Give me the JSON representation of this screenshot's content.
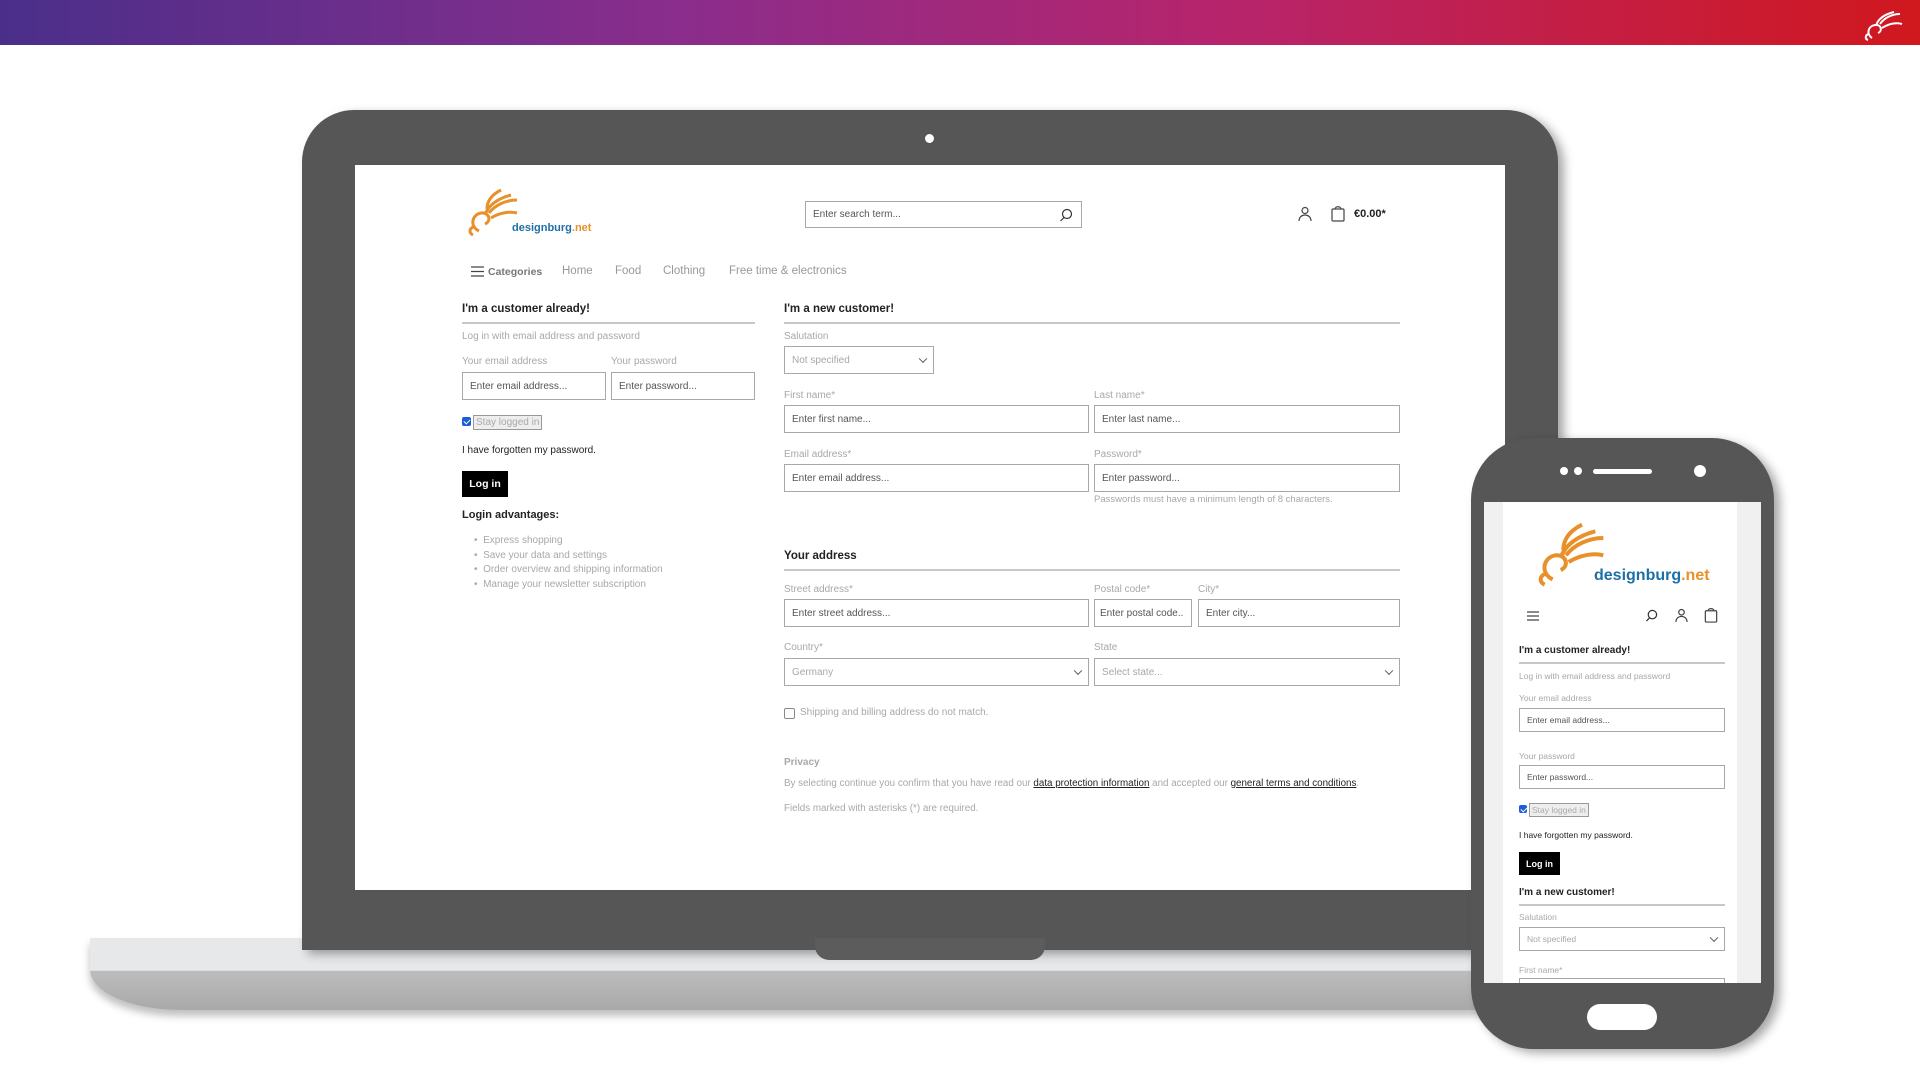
{
  "brand": {
    "name": "designburg",
    "tld": ".net",
    "colors": {
      "gradient_start": "#4a2f8a",
      "gradient_end": "#d0181e",
      "logo_orange": "#e8902a",
      "logo_blue": "#1d6fa8"
    }
  },
  "header": {
    "search_placeholder": "Enter search term...",
    "cart_total": "€0.00*",
    "icons": [
      "search-icon",
      "user-icon",
      "cart-icon"
    ]
  },
  "nav": {
    "categories": "Categories",
    "items": [
      "Home",
      "Food",
      "Clothing",
      "Free time & electronics"
    ]
  },
  "login": {
    "title": "I'm a customer already!",
    "subtitle": "Log in with email address and password",
    "email_label": "Your email address",
    "email_placeholder": "Enter email address...",
    "password_label": "Your password",
    "password_placeholder": "Enter password...",
    "stay_logged_in": "Stay logged in",
    "stay_logged_in_checked": true,
    "forgot": "I have forgotten my password.",
    "login_button": "Log in",
    "advantages_title": "Login advantages:",
    "advantages": [
      "Express shopping",
      "Save your data and settings",
      "Order overview and shipping information",
      "Manage your newsletter subscription"
    ]
  },
  "register": {
    "title": "I'm a new customer!",
    "salutation_label": "Salutation",
    "salutation_value": "Not specified",
    "first_name_label": "First name*",
    "first_name_placeholder": "Enter first name...",
    "last_name_label": "Last name*",
    "last_name_placeholder": "Enter last name...",
    "email_label": "Email address*",
    "email_placeholder": "Enter email address...",
    "password_label": "Password*",
    "password_placeholder": "Enter password...",
    "password_hint": "Passwords must have a minimum length of 8 characters.",
    "address_title": "Your address",
    "street_label": "Street address*",
    "street_placeholder": "Enter street address...",
    "postal_label": "Postal code*",
    "postal_placeholder": "Enter postal code..",
    "city_label": "City*",
    "city_placeholder": "Enter city...",
    "country_label": "Country*",
    "country_value": "Germany",
    "state_label": "State",
    "state_placeholder": "Select state...",
    "different_address": "Shipping and billing address do not match.",
    "different_address_checked": false,
    "privacy_title": "Privacy",
    "privacy_pre": "By selecting continue you confirm that you have read our ",
    "privacy_link1": "data protection information",
    "privacy_mid": " and accepted our ",
    "privacy_link2": "general terms and conditions",
    "privacy_post": ".",
    "required_note": "Fields marked with asterisks (*) are required."
  }
}
